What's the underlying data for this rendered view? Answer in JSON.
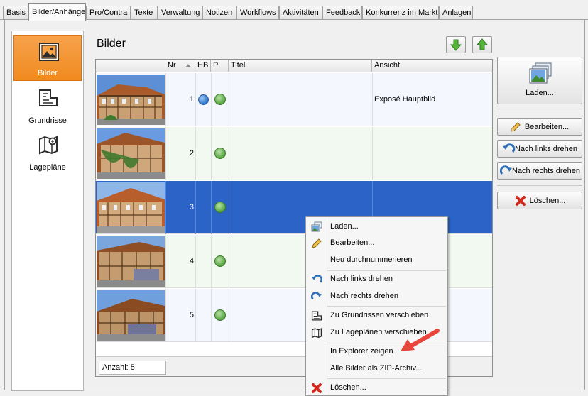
{
  "tabs": [
    {
      "label": "Basis"
    },
    {
      "label": "Bilder/Anhänge"
    },
    {
      "label": "Pro/Contra"
    },
    {
      "label": "Texte"
    },
    {
      "label": "Verwaltung"
    },
    {
      "label": "Notizen"
    },
    {
      "label": "Workflows"
    },
    {
      "label": "Aktivitäten"
    },
    {
      "label": "Feedback"
    },
    {
      "label": "Konkurrenz im Markt"
    },
    {
      "label": "Anlagen"
    }
  ],
  "active_tab": "Bilder/Anhänge",
  "nav": {
    "items": [
      {
        "label": "Bilder",
        "icon": "picture-icon",
        "active": true
      },
      {
        "label": "Grundrisse",
        "icon": "floorplan-icon",
        "active": false
      },
      {
        "label": "Lagepläne",
        "icon": "map-icon",
        "active": false
      }
    ]
  },
  "section": {
    "title": "Bilder"
  },
  "table": {
    "columns": [
      "Nr",
      "HB",
      "P",
      "Titel",
      "Ansicht"
    ],
    "rows": [
      {
        "nr": "1",
        "hb": true,
        "p": true,
        "titel": "",
        "ansicht": "Exposé Hauptbild",
        "selected": false
      },
      {
        "nr": "2",
        "hb": false,
        "p": true,
        "titel": "",
        "ansicht": "",
        "selected": false
      },
      {
        "nr": "3",
        "hb": false,
        "p": true,
        "titel": "",
        "ansicht": "",
        "selected": true
      },
      {
        "nr": "4",
        "hb": false,
        "p": true,
        "titel": "",
        "ansicht": "",
        "selected": false
      },
      {
        "nr": "5",
        "hb": false,
        "p": true,
        "titel": "",
        "ansicht": "",
        "selected": false
      }
    ],
    "count_label": "Anzahl: 5"
  },
  "buttons": {
    "laden": "Laden...",
    "bearbeiten": "Bearbeiten...",
    "links_drehen": "Nach links drehen",
    "rechts_drehen": "Nach rechts drehen",
    "loeschen": "Löschen..."
  },
  "context_menu": {
    "items": [
      {
        "label": "Laden...",
        "icon": "load-images-icon"
      },
      {
        "label": "Bearbeiten...",
        "icon": "pencil-icon"
      },
      {
        "label": "Neu durchnummerieren",
        "icon": ""
      },
      {
        "label": "Nach links drehen",
        "icon": "rotate-left-icon"
      },
      {
        "label": "Nach rechts drehen",
        "icon": "rotate-right-icon"
      },
      {
        "label": "Zu Grundrissen verschieben",
        "icon": "floorplan-icon"
      },
      {
        "label": "Zu Lageplänen verschieben",
        "icon": "map-icon"
      },
      {
        "label": "In Explorer zeigen",
        "icon": ""
      },
      {
        "label": "Alle Bilder als ZIP-Archiv...",
        "icon": ""
      },
      {
        "label": "Löschen...",
        "icon": "delete-x-icon"
      }
    ]
  },
  "colors": {
    "selected_row": "#2b63c6",
    "nav_active": "#f08a1e",
    "annotation_arrow": "#e8453c"
  }
}
